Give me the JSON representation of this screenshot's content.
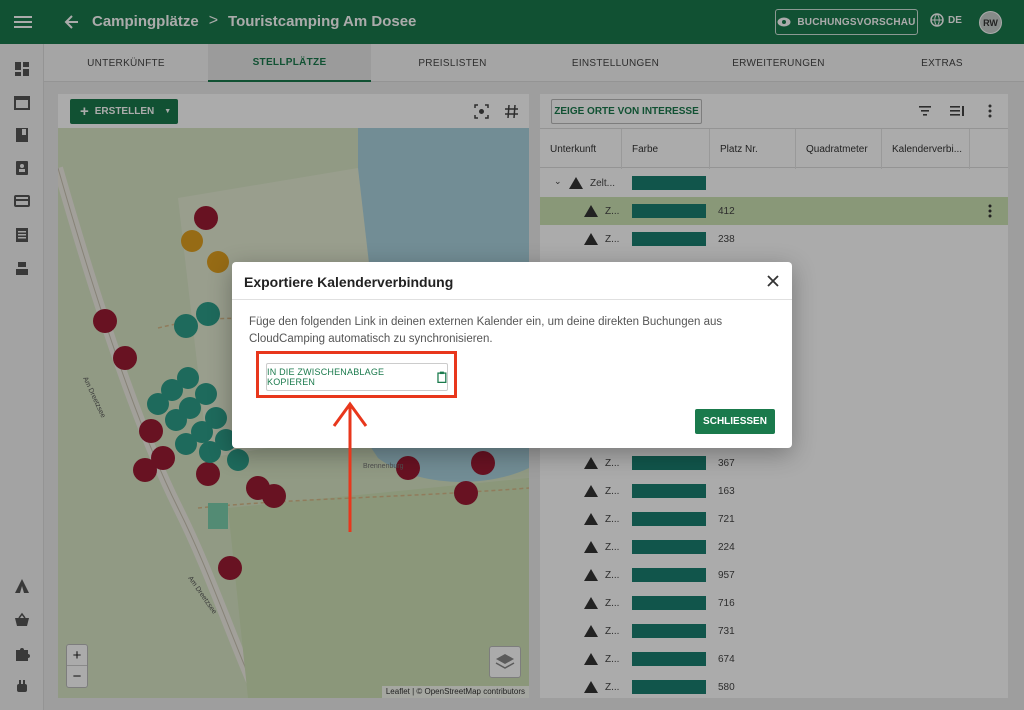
{
  "header": {
    "breadcrumb_root": "Campingplätze",
    "breadcrumb_sep": ">",
    "breadcrumb_current": "Touristcamping Am Dosee",
    "preview_label": "BUCHUNGSVORSCHAU",
    "lang": "DE",
    "avatar": "RW"
  },
  "tabs": [
    {
      "label": "UNTERKÜNFTE"
    },
    {
      "label": "STELLPLÄTZE"
    },
    {
      "label": "PREISLISTEN"
    },
    {
      "label": "EINSTELLUNGEN"
    },
    {
      "label": "ERWEITERUNGEN"
    },
    {
      "label": "EXTRAS"
    }
  ],
  "map": {
    "create_label": "ERSTELLEN",
    "zoom_in": "+",
    "zoom_out": "−",
    "attribution": "Leaflet | © OpenStreetMap contributors",
    "road_label_1": "Am Dreetzsee",
    "road_label_2": "Am Dreetzsee",
    "area_label": "Brennenburg"
  },
  "grid": {
    "poi_label": "ZEIGE ORTE VON INTERESSE",
    "columns": [
      "Unterkunft",
      "Farbe",
      "Platz Nr.",
      "Quadratmeter",
      "Kalenderverbi..."
    ],
    "group": "Zelt...",
    "rows": [
      {
        "name": "Z...",
        "num": "412"
      },
      {
        "name": "Z...",
        "num": "238"
      },
      {
        "name": "Z...",
        "num": "367"
      },
      {
        "name": "Z...",
        "num": "163"
      },
      {
        "name": "Z...",
        "num": "721"
      },
      {
        "name": "Z...",
        "num": "224"
      },
      {
        "name": "Z...",
        "num": "957"
      },
      {
        "name": "Z...",
        "num": "716"
      },
      {
        "name": "Z...",
        "num": "731"
      },
      {
        "name": "Z...",
        "num": "674"
      },
      {
        "name": "Z...",
        "num": "580"
      }
    ]
  },
  "dialog": {
    "title": "Exportiere Kalenderverbindung",
    "text": "Füge den folgenden Link in deinen externen Kalender ein, um deine direkten Buchungen aus CloudCamping automatisch zu synchronisieren.",
    "copy_label": "IN DIE ZWISCHENABLAGE KOPIEREN",
    "close_label": "SCHLIESSEN"
  },
  "colors": {
    "primary": "#1a7a4c",
    "swatch": "#1a7f70",
    "highlight": "#e8371c"
  }
}
